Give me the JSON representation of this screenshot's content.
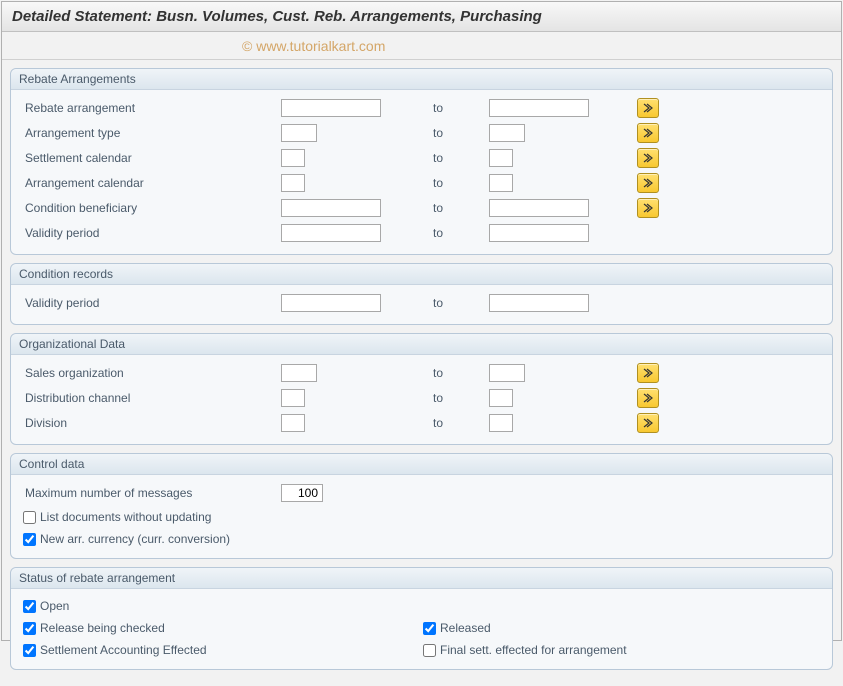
{
  "header": {
    "title": "Detailed Statement: Busn. Volumes, Cust. Reb. Arrangements, Purchasing"
  },
  "watermark": "© www.tutorialkart.com",
  "common": {
    "to": "to"
  },
  "sections": {
    "rebate": {
      "legend": "Rebate Arrangements",
      "rows": {
        "arrangement": {
          "label": "Rebate arrangement"
        },
        "arrType": {
          "label": "Arrangement type"
        },
        "settCal": {
          "label": "Settlement calendar"
        },
        "arrCal": {
          "label": "Arrangement calendar"
        },
        "condBen": {
          "label": "Condition beneficiary"
        },
        "validity": {
          "label": "Validity period"
        }
      }
    },
    "cond": {
      "legend": "Condition records",
      "rows": {
        "validity": {
          "label": "Validity period"
        }
      }
    },
    "org": {
      "legend": "Organizational Data",
      "rows": {
        "salesOrg": {
          "label": "Sales organization"
        },
        "distCh": {
          "label": "Distribution channel"
        },
        "division": {
          "label": "Division"
        }
      }
    },
    "ctrl": {
      "legend": "Control data",
      "maxMsgLabel": "Maximum number of messages",
      "maxMsgValue": "100",
      "listDocs": {
        "label": "List documents without updating",
        "checked": false
      },
      "newArrCurr": {
        "label": "New arr. currency (curr. conversion)",
        "checked": true
      }
    },
    "status": {
      "legend": "Status of rebate arrangement",
      "open": {
        "label": "Open",
        "checked": true
      },
      "releaseCheck": {
        "label": "Release being checked",
        "checked": true
      },
      "released": {
        "label": "Released",
        "checked": true
      },
      "settAcct": {
        "label": "Settlement Accounting Effected",
        "checked": true
      },
      "finalSett": {
        "label": "Final sett. effected for arrangement",
        "checked": false
      }
    }
  }
}
